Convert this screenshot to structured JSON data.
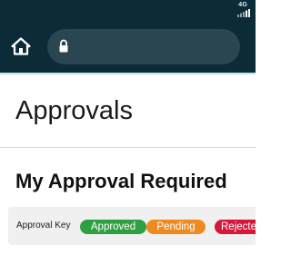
{
  "status_bar": {
    "network": "4G",
    "bg_color": "#0b2b36"
  },
  "browser": {
    "home_icon": "home-icon",
    "lock_icon": "lock-icon",
    "url": ""
  },
  "page": {
    "title": "Approvals"
  },
  "section": {
    "title": "My Approval Required"
  },
  "approval_key": {
    "label": "Approval Key",
    "items": [
      {
        "label": "Approved",
        "color": "#2ea043"
      },
      {
        "label": "Pending",
        "color": "#ef8a1f"
      },
      {
        "label": "Rejected",
        "color": "#d6173b"
      }
    ]
  }
}
